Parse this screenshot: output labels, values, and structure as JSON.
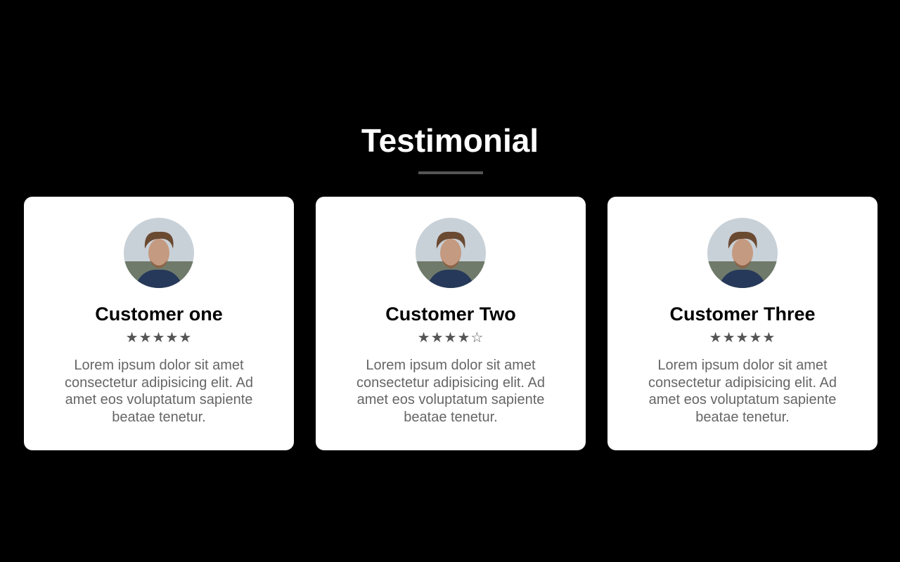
{
  "header": {
    "title": "Testimonial"
  },
  "testimonials": [
    {
      "name": "Customer one",
      "rating": 5,
      "stars": "★★★★★",
      "text": "Lorem ipsum dolor sit amet consectetur adipisicing elit. Ad amet eos voluptatum sapiente beatae tenetur."
    },
    {
      "name": "Customer Two",
      "rating": 4,
      "stars": "★★★★☆",
      "text": "Lorem ipsum dolor sit amet consectetur adipisicing elit. Ad amet eos voluptatum sapiente beatae tenetur."
    },
    {
      "name": "Customer Three",
      "rating": 5,
      "stars": "★★★★★",
      "text": "Lorem ipsum dolor sit amet consectetur adipisicing elit. Ad amet eos voluptatum sapiente beatae tenetur."
    }
  ]
}
